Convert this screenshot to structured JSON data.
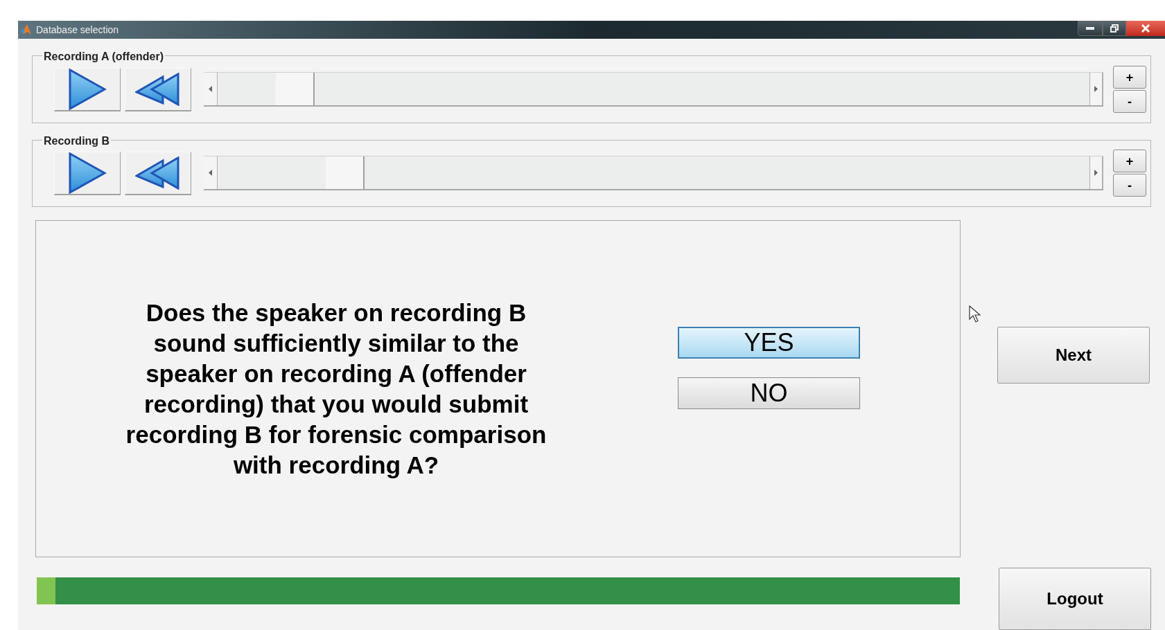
{
  "window": {
    "title": "Database selection"
  },
  "recordings": [
    {
      "label": "Recording A (offender)",
      "level": 0.07
    },
    {
      "label": "Recording B",
      "level": 0.13
    }
  ],
  "zoom_buttons": [
    "+",
    "-"
  ],
  "question": "Does the speaker on recording B sound sufficiently similar to the speaker on recording A (offender recording) that you would submit recording B for forensic comparison with recording A?",
  "answers": [
    {
      "label": "YES",
      "selected": true
    },
    {
      "label": "NO",
      "selected": false
    }
  ],
  "next_button": "Next",
  "logout_button": "Logout",
  "progress": {
    "level": 0.02
  }
}
